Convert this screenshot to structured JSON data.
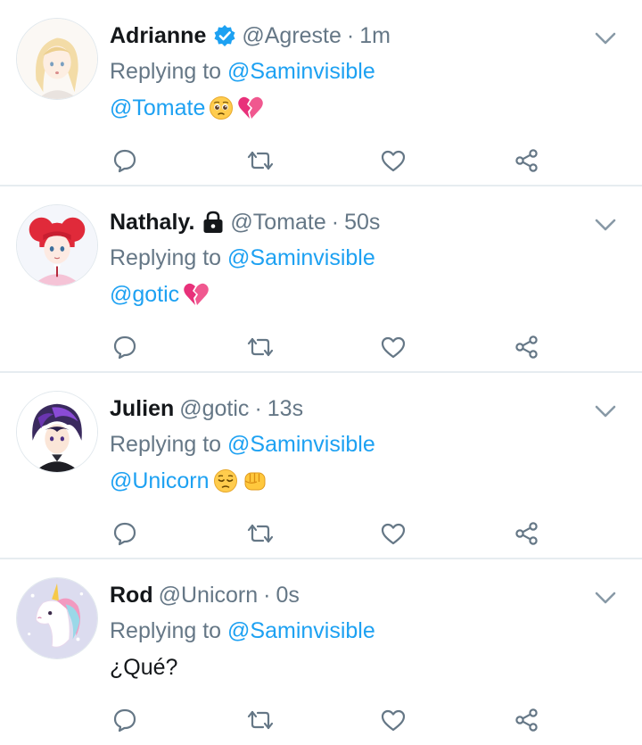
{
  "colors": {
    "link": "#1da1f2",
    "muted": "#657786",
    "text": "#14171a",
    "divider": "#e6ecf0",
    "verified": "#1da1f2"
  },
  "tweets": [
    {
      "name": "Adrianne",
      "badge": "verified-icon",
      "handle": "@Agreste",
      "separator": "·",
      "time": "1m",
      "replying_prefix": "Replying to",
      "replying_to": "@Saminvisible",
      "mention": "@Tomate",
      "text": "",
      "emojis": [
        "pleading-face-emoji",
        "broken-heart-emoji"
      ]
    },
    {
      "name": "Nathaly.",
      "badge": "lock-icon",
      "handle": "@Tomate",
      "separator": "·",
      "time": "50s",
      "replying_prefix": "Replying to",
      "replying_to": "@Saminvisible",
      "mention": "@gotic",
      "text": "",
      "emojis": [
        "broken-heart-emoji"
      ]
    },
    {
      "name": "Julien",
      "badge": "",
      "handle": "@gotic",
      "separator": "·",
      "time": "13s",
      "replying_prefix": "Replying to",
      "replying_to": "@Saminvisible",
      "mention": "@Unicorn",
      "text": "",
      "emojis": [
        "pensive-face-emoji",
        "fist-emoji"
      ]
    },
    {
      "name": "Rod",
      "badge": "",
      "handle": "@Unicorn",
      "separator": "·",
      "time": "0s",
      "replying_prefix": "Replying to",
      "replying_to": "@Saminvisible",
      "mention": "",
      "text": "¿Qué?",
      "emojis": []
    }
  ],
  "action_icons": [
    "reply-icon",
    "retweet-icon",
    "like-icon",
    "share-icon"
  ]
}
